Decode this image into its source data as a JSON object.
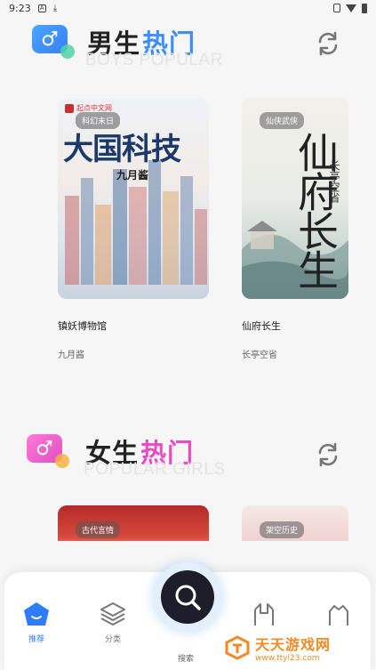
{
  "status_bar": {
    "time": "9:23",
    "icons": [
      "a-icon",
      "download-icon",
      "vibrate-icon",
      "wifi-icon",
      "battery-icon"
    ]
  },
  "sections": {
    "boys": {
      "title_plain": "男生",
      "title_accent": "热门",
      "subtitle": "BOYS POPULAR",
      "accent_color": "#3e8ef7",
      "books": [
        {
          "name": "镇妖博物馆",
          "author": "九月酱",
          "cover_tag": "科幻末日",
          "cover_title": "大国科技",
          "cover_author": "九月酱",
          "cover_publisher": "起点中文网"
        },
        {
          "name": "仙府长生",
          "author": "长亭空省",
          "cover_tag": "仙侠武侠",
          "cover_title": "仙府长生",
          "cover_author": "长亭空省"
        }
      ]
    },
    "girls": {
      "title_plain": "女生",
      "title_accent": "热门",
      "subtitle": "POPULAR GIRLS",
      "accent_color": "#e84cc3",
      "books": [
        {
          "cover_tag": "古代言情"
        },
        {
          "cover_tag": "架空历史"
        }
      ]
    }
  },
  "tabbar": {
    "tabs": [
      {
        "label": "推荐",
        "icon": "home-icon",
        "active": true
      },
      {
        "label": "分类",
        "icon": "layers-icon",
        "active": false
      },
      {
        "label": "搜索",
        "icon": "search-icon",
        "active": false
      },
      {
        "label": "",
        "icon": "bookshelf-icon",
        "active": false
      },
      {
        "label": "",
        "icon": "profile-icon",
        "active": false
      }
    ]
  },
  "watermark": {
    "name": "天天游戏网",
    "url": "www.ttyl23.com"
  }
}
